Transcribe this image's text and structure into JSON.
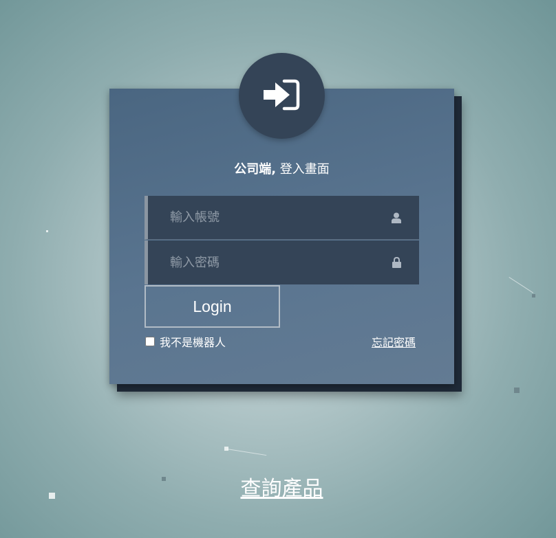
{
  "login": {
    "title_bold": "公司端,",
    "title_rest": " 登入畫面",
    "username_placeholder": "輸入帳號",
    "password_placeholder": "輸入密碼",
    "login_label": "Login",
    "robot_label": "我不是機器人",
    "forgot_label": "忘記密碼"
  },
  "footer": {
    "query_label": "查詢產品"
  },
  "icons": {
    "logo": "sign-in-icon",
    "user": "user-icon",
    "lock": "lock-icon"
  },
  "colors": {
    "card": "#56708b",
    "field": "#344457",
    "logo_circle": "#344457"
  }
}
